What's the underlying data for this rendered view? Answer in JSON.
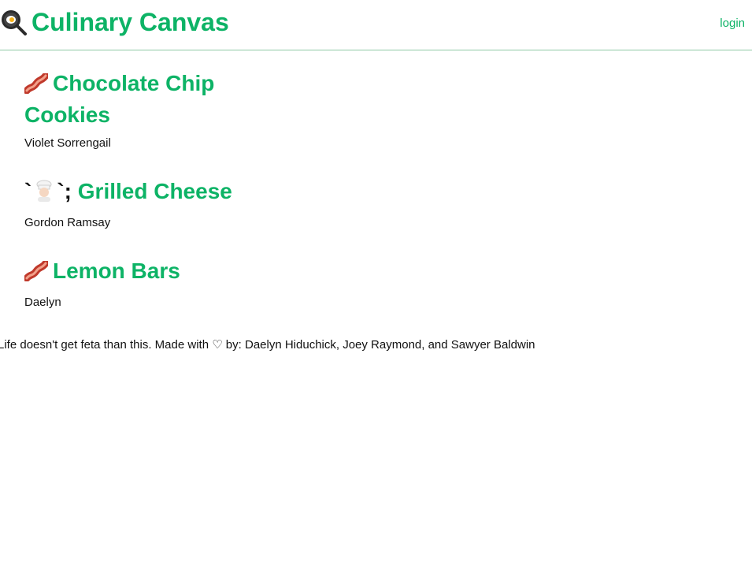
{
  "header": {
    "title": "Culinary Canvas",
    "brand_icon": "frying-pan-icon",
    "login_label": "login"
  },
  "recipes": [
    {
      "icon": "bacon-icon",
      "prefix": "",
      "title": "Chocolate Chip Cookies",
      "author": "Violet Sorrengail"
    },
    {
      "icon": "chef-icon",
      "prefix": "`",
      "suffix": "`;",
      "title": "Grilled Cheese",
      "author": "Gordon Ramsay"
    },
    {
      "icon": "bacon-icon",
      "prefix": "",
      "title": "Lemon Bars",
      "author": "Daelyn"
    }
  ],
  "footer": {
    "text": "Life doesn't get feta than this. Made with ♡ by: Daelyn Hiduchick, Joey Raymond, and Sawyer Baldwin"
  },
  "colors": {
    "accent": "#0db366",
    "divider": "#8fc9a5"
  }
}
